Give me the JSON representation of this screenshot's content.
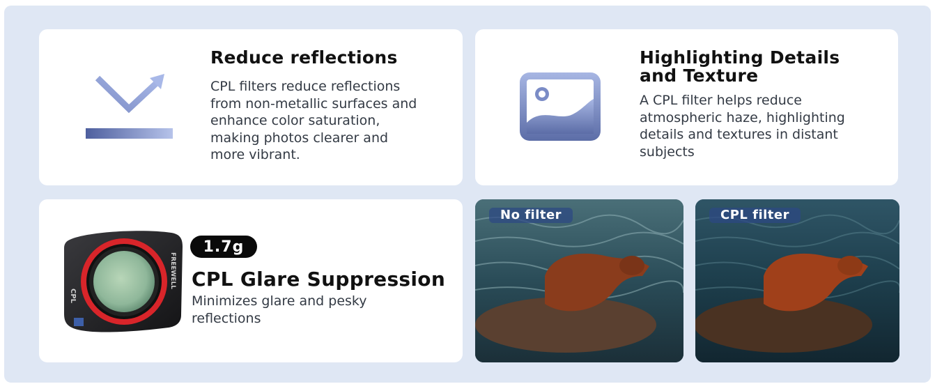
{
  "features": [
    {
      "title": "Reduce reflections",
      "body": "CPL filters reduce reflections from non-metallic surfaces and enhance color saturation, making photos clearer and more vibrant.",
      "icon": "reflection-arrow-icon"
    },
    {
      "title": "Highlighting Details and Texture",
      "body": "A CPL filter helps reduce atmospheric haze, highlighting details and textures in distant subjects",
      "icon": "landscape-image-icon"
    }
  ],
  "product": {
    "weight": "1.7g",
    "title": "CPL Glare Suppression",
    "body": "Minimizes glare and pesky reflections",
    "filter_type_text": "CPL",
    "brand_text": "FREEWELL",
    "ring_color": "#d8252a"
  },
  "comparison": {
    "left_label": "No filter",
    "right_label": "CPL filter"
  },
  "colors": {
    "background": "#dfe7f4",
    "card": "#ffffff",
    "icon_gradient_dark": "#5a6ba4",
    "icon_gradient_light": "#a9b7e4"
  }
}
